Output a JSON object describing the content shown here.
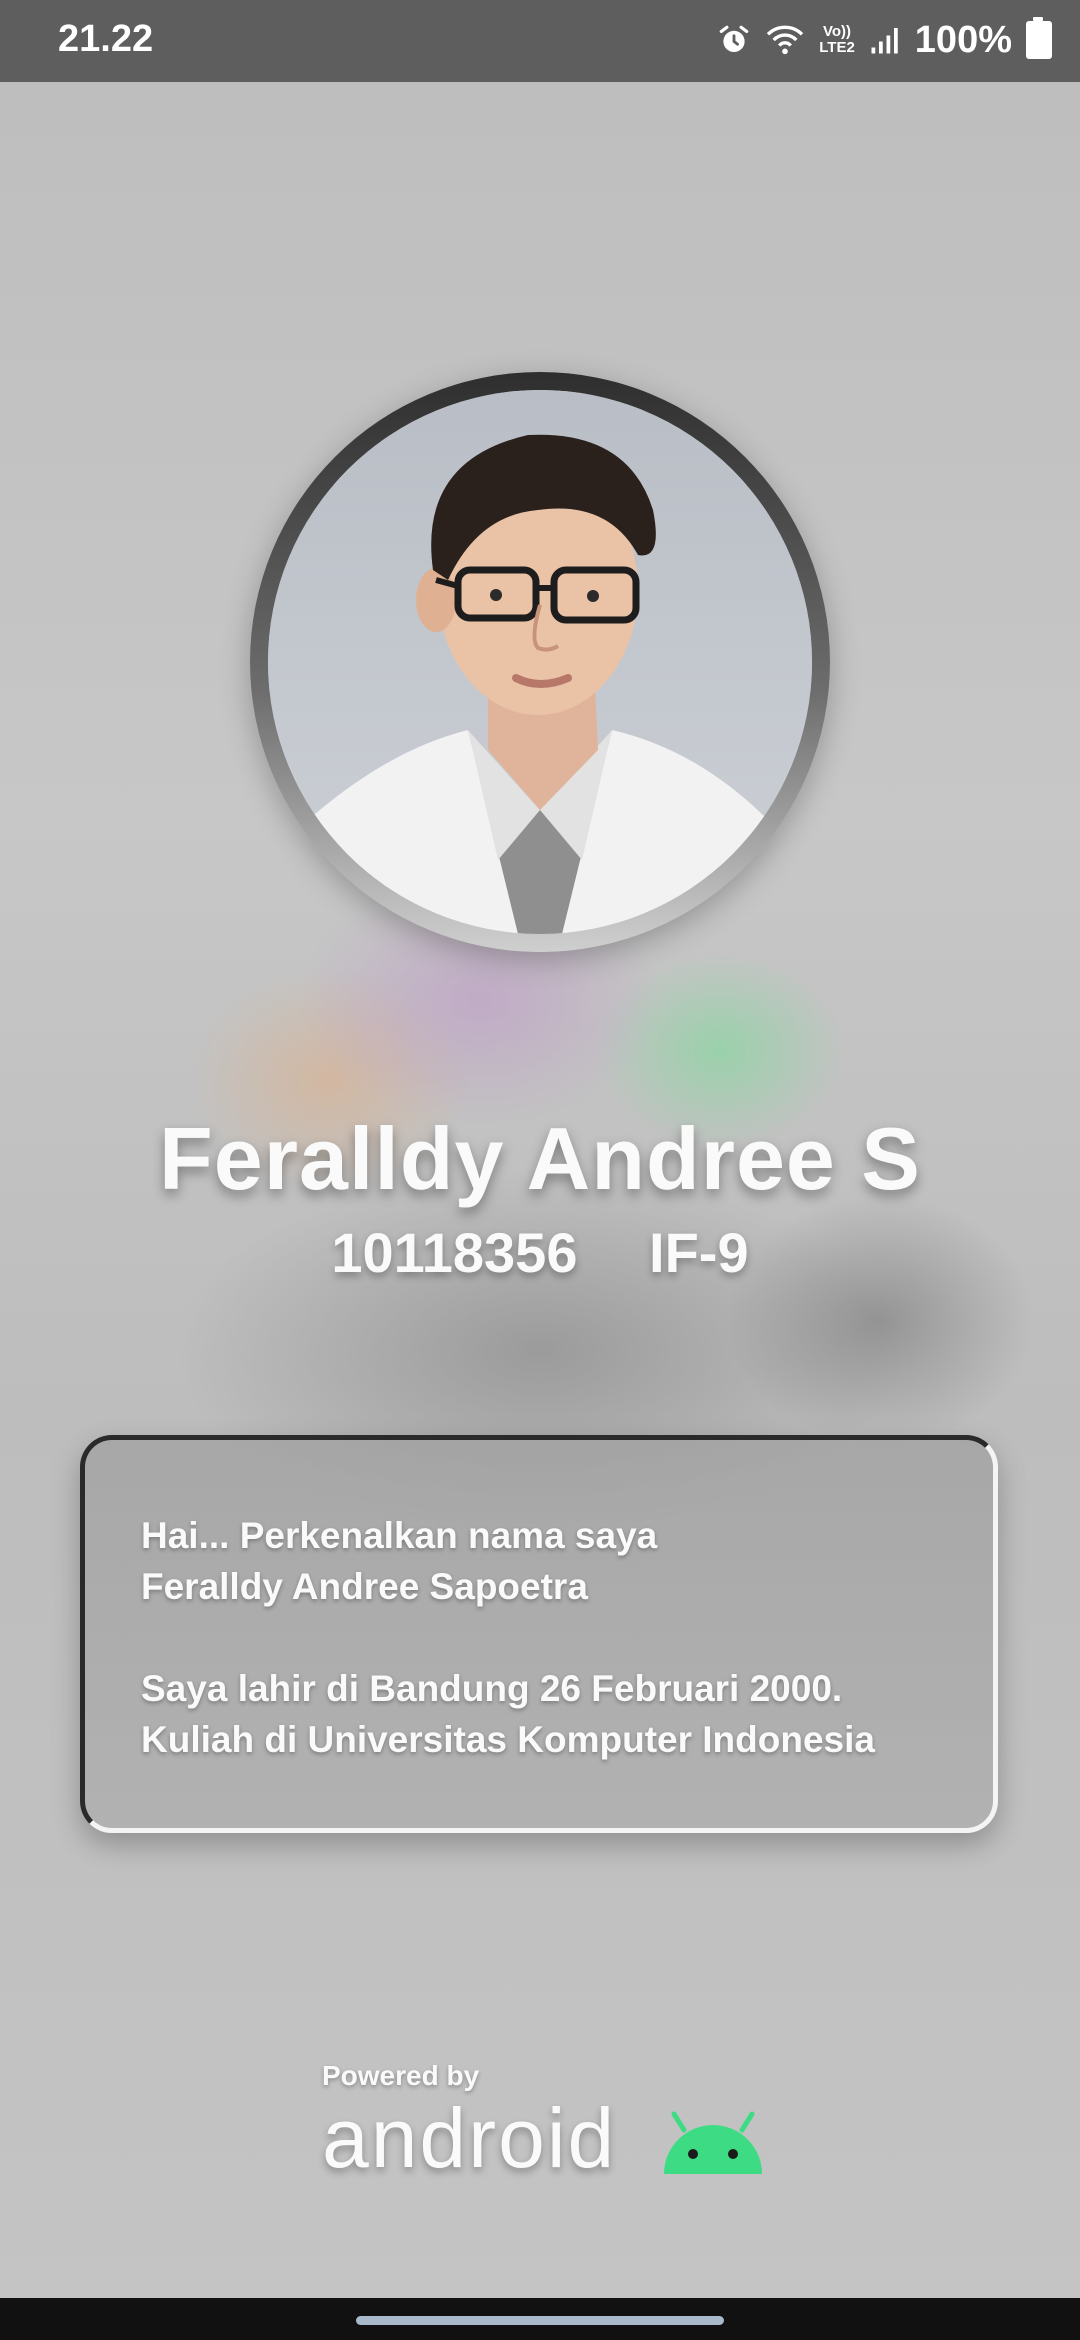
{
  "status_bar": {
    "time": "21.22",
    "network_label_top": "Vo))",
    "network_label_bottom": "LTE2",
    "battery": "100%"
  },
  "profile": {
    "name": "Feralldy Andree S",
    "student_id": "10118356",
    "class": "IF-9"
  },
  "intro": {
    "line1": "Hai... Perkenalkan nama saya",
    "line2": "Feralldy Andree Sapoetra",
    "line3": "Saya lahir di Bandung 26 Februari 2000.",
    "line4": "Kuliah di Universitas Komputer Indonesia"
  },
  "footer": {
    "powered_by": "Powered by",
    "brand": "android",
    "logo_color": "#3ddc84"
  }
}
